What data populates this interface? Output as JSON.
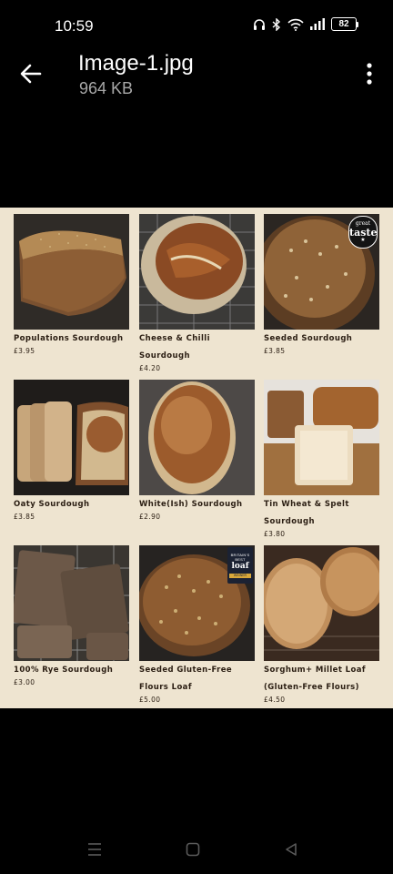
{
  "status_bar": {
    "time": "10:59",
    "battery": "82"
  },
  "app_bar": {
    "file_name": "Image-1.jpg",
    "file_size": "964 KB"
  },
  "products": [
    {
      "name": "Populations Sourdough",
      "price": "£3.95"
    },
    {
      "name": "Cheese & Chilli",
      "name2": "Sourdough",
      "price": "£4.20"
    },
    {
      "name": "Seeded Sourdough",
      "price": "£3.85",
      "badge": {
        "line1": "great",
        "line2": "taste",
        "line3": "★"
      }
    },
    {
      "name": "Oaty Sourdough",
      "price": "£3.85"
    },
    {
      "name": "White(Ish) Sourdough",
      "price": "£2.90"
    },
    {
      "name": "Tin Wheat & Spelt",
      "name2": "Sourdough",
      "price": "£3.80"
    },
    {
      "name": "100% Rye Sourdough",
      "price": "£3.00"
    },
    {
      "name": "Seeded Gluten-Free",
      "name2": "Flours Loaf",
      "price": "£5.00",
      "badge": {
        "line1": "BRITAIN'S BEST",
        "line2": "loaf",
        "line3": "WINNER"
      }
    },
    {
      "name": "Sorghum+ Millet Loaf",
      "name2": "(Gluten-Free Flours)",
      "price": "£4.50"
    }
  ],
  "icons": {
    "back": "arrow-left-icon",
    "menu": "more-vertical-icon",
    "headphones": "headphones-icon",
    "bluetooth": "bluetooth-icon",
    "wifi": "wifi-icon",
    "signal": "signal-icon",
    "nav_recents": "recents-icon",
    "nav_home": "home-icon",
    "nav_back": "back-triangle-icon"
  },
  "colors": {
    "background": "#000000",
    "image_bg": "#eee4d0",
    "text_dark": "#2a1d12",
    "secondary_text": "#a8a8a8"
  }
}
